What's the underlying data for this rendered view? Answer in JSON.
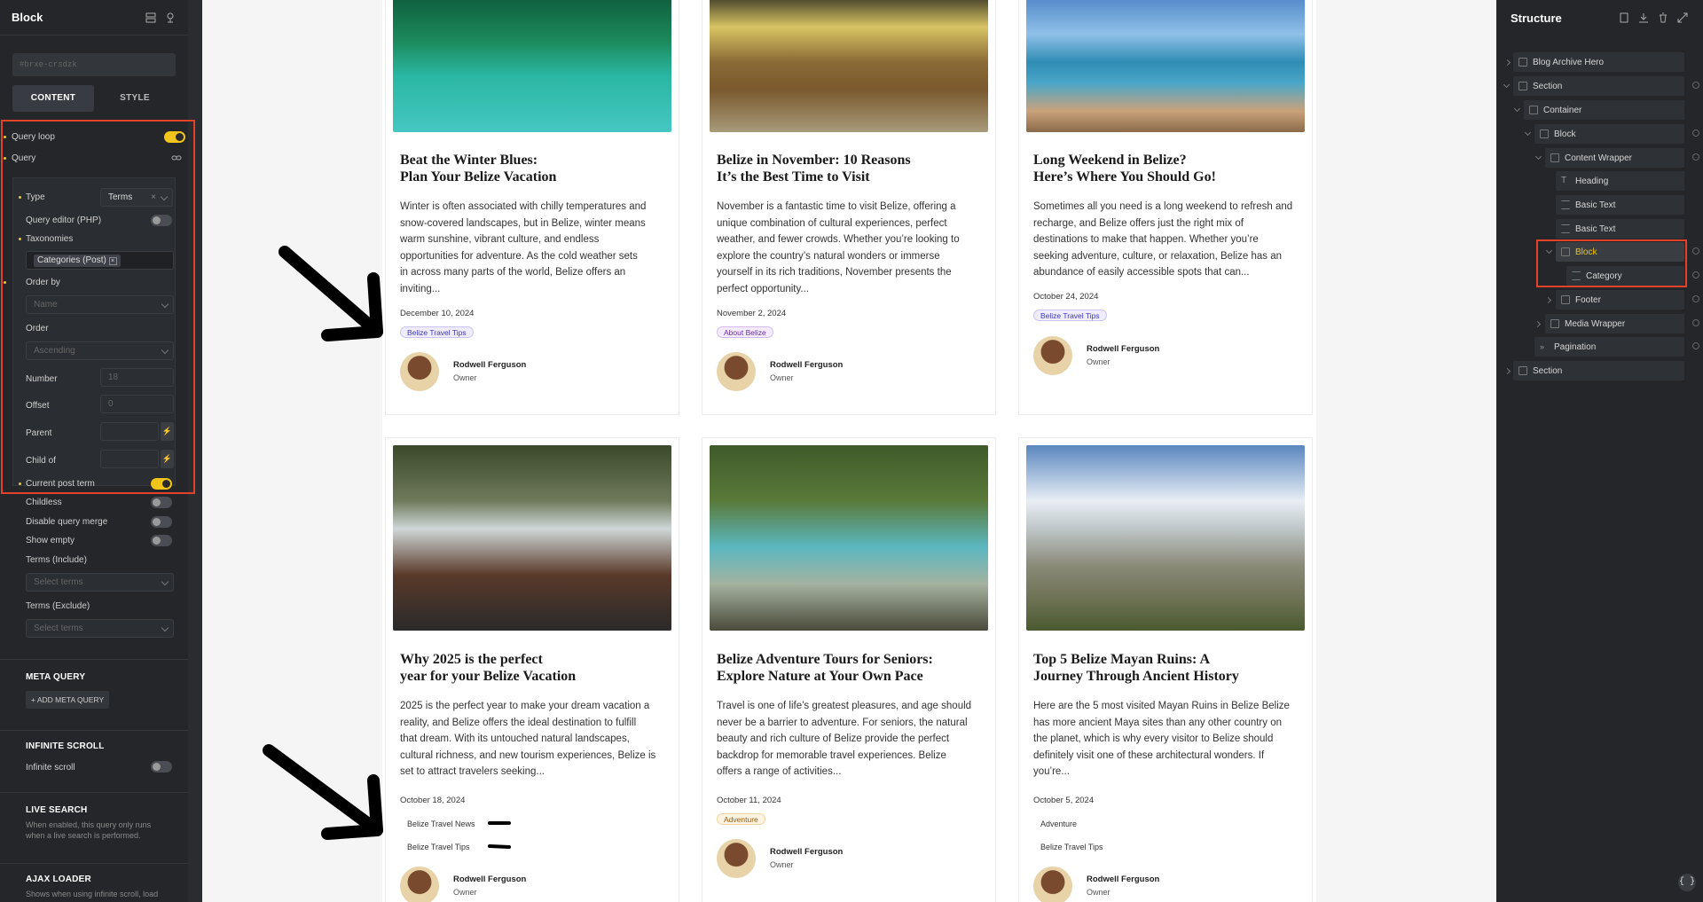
{
  "left_panel": {
    "title": "Block",
    "id_placeholder": "#brxe-crsdzk",
    "tabs": [
      {
        "label": "CONTENT",
        "active": true
      },
      {
        "label": "STYLE",
        "active": false
      }
    ],
    "query_loop": {
      "label": "Query loop",
      "on": true
    },
    "query": {
      "label": "Query"
    },
    "type": {
      "label": "Type",
      "value": "Terms"
    },
    "query_editor": {
      "label": "Query editor (PHP)",
      "on": false
    },
    "taxonomies": {
      "label": "Taxonomies",
      "value": "Categories (Post)"
    },
    "order_by": {
      "label": "Order by",
      "placeholder": "Name"
    },
    "order": {
      "label": "Order",
      "placeholder": "Ascending"
    },
    "number": {
      "label": "Number",
      "placeholder": "18"
    },
    "offset": {
      "label": "Offset",
      "placeholder": "0"
    },
    "parent": {
      "label": "Parent"
    },
    "child_of": {
      "label": "Child of"
    },
    "current_post_term": {
      "label": "Current post term",
      "on": true
    },
    "childless": {
      "label": "Childless",
      "on": false
    },
    "disable_query_merge": {
      "label": "Disable query merge",
      "on": false
    },
    "show_empty": {
      "label": "Show empty",
      "on": false
    },
    "terms_include": {
      "label": "Terms (Include)",
      "placeholder": "Select terms"
    },
    "terms_exclude": {
      "label": "Terms (Exclude)",
      "placeholder": "Select terms"
    },
    "meta_query": {
      "heading": "META QUERY",
      "button": "ADD META QUERY"
    },
    "infinite_scroll": {
      "heading": "INFINITE SCROLL",
      "label": "Infinite scroll",
      "on": false
    },
    "live_search": {
      "heading": "LIVE SEARCH",
      "desc1": "When enabled, this query only runs",
      "desc2": "when a live search is performed."
    },
    "ajax_loader": {
      "heading": "AJAX LOADER",
      "desc": "Shows when using infinite scroll, load"
    }
  },
  "structure": {
    "title": "Structure",
    "items": [
      {
        "label": "Blog Archive Hero",
        "icon": "section-icon"
      },
      {
        "label": "Section",
        "icon": "section-icon"
      },
      {
        "label": "Container",
        "icon": "container-icon"
      },
      {
        "label": "Block",
        "icon": "block-icon"
      },
      {
        "label": "Content Wrapper",
        "icon": "block-icon"
      },
      {
        "label": "Heading",
        "icon": "heading-icon"
      },
      {
        "label": "Basic Text",
        "icon": "text-icon"
      },
      {
        "label": "Basic Text",
        "icon": "text-icon"
      },
      {
        "label": "Block",
        "icon": "block-icon",
        "selected": true
      },
      {
        "label": "Category",
        "icon": "text-icon"
      },
      {
        "label": "Footer",
        "icon": "block-icon"
      },
      {
        "label": "Media Wrapper",
        "icon": "block-icon"
      },
      {
        "label": "Pagination",
        "icon": "pagination-icon"
      },
      {
        "label": "Section",
        "icon": "section-icon"
      }
    ]
  },
  "posts": [
    {
      "title1": "Beat the Winter Blues:",
      "title2": "Plan Your Belize Vacation",
      "excerpt": [
        "Winter is often associated with chilly temperatures and",
        "snow-covered landscapes, but in Belize, winter means",
        "warm sunshine, vibrant culture, and endless",
        "opportunities for adventure. As the cold weather sets",
        "in across many parts of the world, Belize offers an",
        "inviting..."
      ],
      "date": "December 10, 2024",
      "tags": [
        "Belize Travel Tips"
      ],
      "author": "Rodwell Ferguson",
      "role": "Owner"
    },
    {
      "title1": "Belize in November: 10 Reasons",
      "title2": "It’s the Best Time to Visit",
      "excerpt": [
        "November is a fantastic time to visit Belize, offering a",
        "unique combination of cultural experiences, perfect",
        "weather, and fewer crowds. Whether you’re looking to",
        "explore the country’s natural wonders or immerse",
        "yourself in its rich traditions, November presents the",
        "perfect opportunity..."
      ],
      "date": "November 2, 2024",
      "tags": [
        "About Belize"
      ],
      "author": "Rodwell Ferguson",
      "role": "Owner"
    },
    {
      "title1": "Long Weekend in Belize?",
      "title2": "Here’s Where You Should Go!",
      "excerpt": [
        "Sometimes all you need is a long weekend to refresh and",
        "recharge, and Belize offers just the right mix of",
        "destinations to make that happen. Whether you’re",
        "seeking adventure, culture, or relaxation, Belize has an",
        "abundance of easily accessible spots that can..."
      ],
      "date": "October 24, 2024",
      "tags": [
        "Belize Travel Tips"
      ],
      "author": "Rodwell Ferguson",
      "role": "Owner"
    },
    {
      "title1": "Why 2025 is the perfect",
      "title2": "year for your Belize Vacation",
      "excerpt": [
        "2025 is the perfect year to make your dream vacation a",
        "reality, and Belize offers the ideal destination to fulfill",
        "that dream. With its untouched natural landscapes,",
        "cultural richness, and new tourism experiences, Belize is",
        "set to attract travelers seeking..."
      ],
      "date": "October 18, 2024",
      "tags": [
        "Belize Travel News",
        "Belize Travel Tips"
      ],
      "author": "Rodwell Ferguson",
      "role": "Owner"
    },
    {
      "title1": "Belize Adventure Tours for Seniors:",
      "title2": "Explore Nature at Your Own Pace",
      "excerpt": [
        "Travel is one of life’s greatest pleasures, and age should",
        "never be a barrier to adventure. For seniors, the natural",
        "beauty and rich culture of Belize provide the perfect",
        "backdrop for memorable travel experiences. Belize",
        "offers a range of activities..."
      ],
      "date": "October 11, 2024",
      "tags": [
        "Adventure"
      ],
      "author": "Rodwell Ferguson",
      "role": "Owner"
    },
    {
      "title1": "Top 5 Belize Mayan Ruins: A",
      "title2": "Journey Through Ancient History",
      "excerpt": [
        "Here are the 5 most visited Mayan Ruins in Belize Belize",
        "has more ancient Maya sites than any other country on",
        "the planet, which is why every visitor to Belize should",
        "definitely visit one of these architectural wonders. If",
        "you’re..."
      ],
      "date": "October 5, 2024",
      "tags": [
        "Adventure",
        "Belize Travel Tips"
      ],
      "author": "Rodwell Ferguson",
      "role": "Owner"
    }
  ],
  "corner_button": "{ }"
}
